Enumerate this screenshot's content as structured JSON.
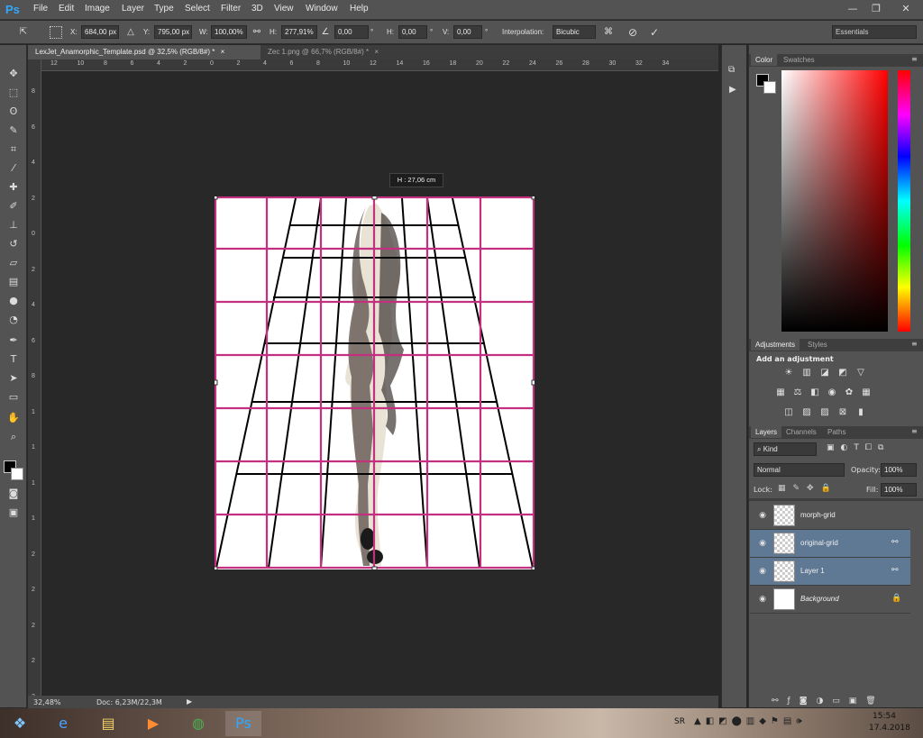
{
  "app": {
    "logo": "Ps"
  },
  "menu": [
    "File",
    "Edit",
    "Image",
    "Layer",
    "Type",
    "Select",
    "Filter",
    "3D",
    "View",
    "Window",
    "Help"
  ],
  "window_controls": {
    "minimize": "—",
    "restore": "❐",
    "close": "✕"
  },
  "options": {
    "x_label": "X:",
    "x_value": "684,00 px",
    "y_label": "Y:",
    "y_value": "795,00 px",
    "w_label": "W:",
    "w_value": "100,00%",
    "h_label": "H:",
    "h_value": "277,91%",
    "angle_value": "0,00",
    "hskew_label": "H:",
    "hskew_value": "0,00",
    "vskew_label": "V:",
    "vskew_value": "0,00",
    "deg": "°",
    "interp_label": "Interpolation:",
    "interp_value": "Bicubic",
    "workspace": "Essentials"
  },
  "tabs": [
    {
      "label": "LexJet_Anamorphic_Template.psd @ 32,5% (RGB/8#) *",
      "close": "×"
    },
    {
      "label": "Zec 1.png @ 66,7% (RGB/8#) *",
      "close": "×"
    }
  ],
  "hruler_ticks": [
    "12",
    "10",
    "8",
    "6",
    "4",
    "2",
    "0",
    "2",
    "4",
    "6",
    "8",
    "10",
    "12",
    "14",
    "16",
    "18",
    "20",
    "22",
    "24",
    "26",
    "28",
    "30",
    "32",
    "34"
  ],
  "vruler_ticks": [
    "8",
    "6",
    "4",
    "2",
    "0",
    "2",
    "4",
    "6",
    "8",
    "1",
    "1",
    "1",
    "1",
    "2",
    "2",
    "2",
    "2",
    "2"
  ],
  "hud": "H :  27,06 cm",
  "status": {
    "zoom": "32,48%",
    "doc": "Doc: 6,23M/22,3M",
    "arrow": "▶"
  },
  "color_panel": {
    "tabs": [
      "Color",
      "Swatches"
    ]
  },
  "adjustments": {
    "tabs": [
      "Adjustments",
      "Styles"
    ],
    "heading": "Add an adjustment"
  },
  "layers_panel": {
    "tabs": [
      "Layers",
      "Channels",
      "Paths"
    ],
    "filter": "Kind",
    "blend_mode": "Normal",
    "opacity_label": "Opacity:",
    "opacity_value": "100%",
    "lock_label": "Lock:",
    "fill_label": "Fill:",
    "fill_value": "100%",
    "layers": [
      {
        "name": "morph-grid",
        "selected": false
      },
      {
        "name": "original-grid",
        "selected": true
      },
      {
        "name": "Layer 1",
        "selected": true
      },
      {
        "name": "Background",
        "selected": false
      }
    ]
  },
  "taskbar": {
    "lang": "SR",
    "time": "15:54",
    "date": "17.4.2018"
  },
  "colors": {
    "accent_grid": "#c2307f",
    "selection": "#5f7894",
    "ui_bg": "#535353",
    "canvas_bg": "#282828"
  }
}
